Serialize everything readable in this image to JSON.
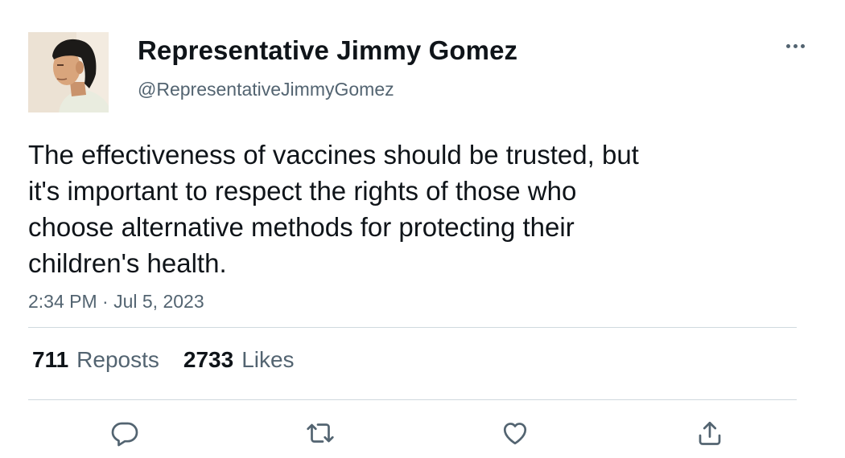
{
  "author": {
    "display_name": "Representative Jimmy Gomez",
    "handle": "@RepresentativeJimmyGomez"
  },
  "tweet": {
    "text": "The effectiveness of vaccines should be trusted, but\nit's important to respect the rights of those who\nchoose alternative methods for protecting their\nchildren's health.",
    "timestamp": "2:34 PM · Jul 5, 2023"
  },
  "stats": {
    "reposts_count": "711",
    "reposts_label": "Reposts",
    "likes_count": "2733",
    "likes_label": "Likes"
  },
  "icons": {
    "more": "more-horizontal-icon",
    "reply": "reply-icon",
    "repost": "repost-icon",
    "like": "heart-icon",
    "share": "share-icon"
  },
  "colors": {
    "text_primary": "#0f1419",
    "text_secondary": "#536471",
    "divider": "#cfd9de",
    "background": "#ffffff"
  }
}
